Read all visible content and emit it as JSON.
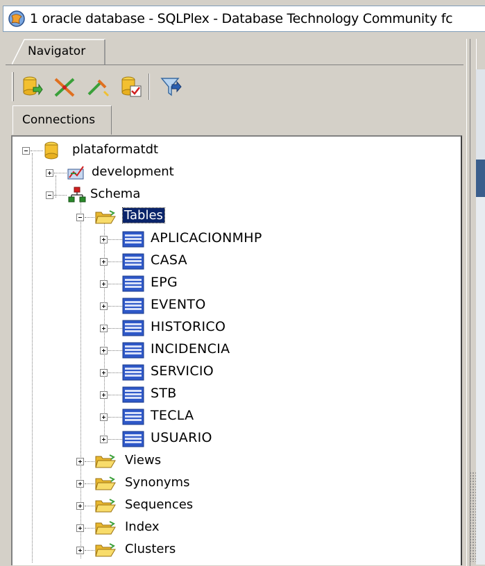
{
  "window": {
    "title": "1 oracle database - SQLPlex - Database Technology Community fc",
    "icon": "app-globe-icon"
  },
  "navigator": {
    "tab_label": "Navigator",
    "toolbar": [
      {
        "name": "new-connection-icon"
      },
      {
        "name": "disconnect-icon"
      },
      {
        "name": "edit-connection-icon"
      },
      {
        "name": "properties-icon"
      },
      {
        "name": "filter-icon"
      }
    ]
  },
  "connections": {
    "tab_label": "Connections",
    "tree": {
      "root": "plataformatdt",
      "development": "development",
      "schema": "Schema",
      "tables_label": "Tables",
      "tables": [
        "APLICACIONMHP",
        "CASA",
        "EPG",
        "EVENTO",
        "HISTORICO",
        "INCIDENCIA",
        "SERVICIO",
        "STB",
        "TECLA",
        "USUARIO"
      ],
      "folders": [
        "Views",
        "Synonyms",
        "Sequences",
        "Index",
        "Clusters"
      ]
    }
  },
  "colors": {
    "selection": "#0a246a",
    "panel_bg": "#d4d0c8",
    "folder": "#f5c542"
  }
}
